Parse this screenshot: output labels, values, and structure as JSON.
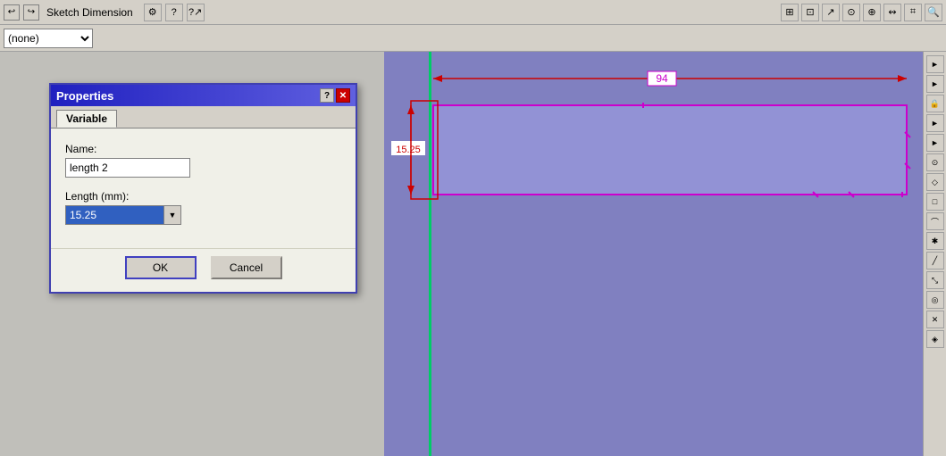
{
  "titlebar": {
    "undo_label": "↩",
    "redo_label": "↪",
    "title": "Sketch Dimension",
    "help_icon": "?",
    "help2_icon": "?↗"
  },
  "dropdown": {
    "selected": "(none)",
    "options": [
      "(none)"
    ]
  },
  "toolbar_right": {
    "icons": [
      "⊞",
      "⊡",
      "↗",
      "⊙",
      "⊕",
      "↭",
      "⌗",
      "🔍"
    ]
  },
  "right_toolbar": {
    "icons": [
      "►",
      "►",
      "🔒",
      "►",
      "►",
      "⊙",
      "►",
      "►",
      "►",
      "►",
      "►",
      "►",
      "►",
      "►",
      "►"
    ]
  },
  "dialog": {
    "title": "Properties",
    "help_btn": "?",
    "close_btn": "✕",
    "tab_variable": "Variable",
    "name_label": "Name:",
    "name_value": "length 2",
    "length_label": "Length (mm):",
    "length_value": "15.25",
    "ok_label": "OK",
    "cancel_label": "Cancel"
  },
  "canvas": {
    "dim_horizontal_value": "94",
    "dim_vertical_value": "15.25",
    "background_color": "#8888cc"
  }
}
